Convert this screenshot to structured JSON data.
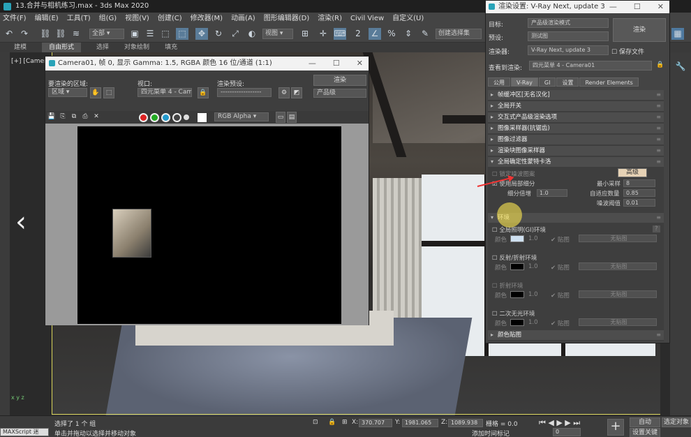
{
  "app": {
    "title": "13.合并与相机练习.max - 3ds Max 2020"
  },
  "menu": [
    "文件(F)",
    "编辑(E)",
    "工具(T)",
    "组(G)",
    "视图(V)",
    "创建(C)",
    "修改器(M)",
    "动画(A)",
    "图形编辑器(D)",
    "渲染(R)",
    "Civil View",
    "自定义(U)"
  ],
  "toolbar": {
    "select_filter": "全部",
    "view_dropdown": "视图",
    "selection_set": "创建选择集"
  },
  "ribbon": [
    "建模",
    "自由形式",
    "选择",
    "对象绘制",
    "填充"
  ],
  "viewport": {
    "label": "[+] [Camera01]",
    "axis": "x y z"
  },
  "frame_buffer": {
    "title": "Camera01, 帧 0, 显示 Gamma: 1.5, RGBA 颜色 16 位/通道 (1:1)",
    "area_label": "要渲染的区域:",
    "area_value": "区域",
    "viewport_label": "视口:",
    "viewport_value": "四元菜单 4 - Camera01",
    "preset_label": "渲染预设:",
    "preset_value": "------------------",
    "render_button": "渲染",
    "product_level": "产品级",
    "channel": "RGB Alpha"
  },
  "render_setup": {
    "title": "渲染设置: V-Ray Next, update 3",
    "target_label": "目标:",
    "target_value": "产品级渲染模式",
    "preset_label": "预设:",
    "preset_value": "测试图",
    "renderer_label": "渲染器:",
    "renderer_value": "V-Ray Next, update 3",
    "save_file": "保存文件",
    "view_label": "查看到渲染:",
    "view_value": "四元菜单 4 - Camera01",
    "render_button": "渲染",
    "tabs": [
      "公用",
      "V-Ray",
      "GI",
      "设置",
      "Render Elements"
    ],
    "rollouts": [
      "帧缓冲区[无名汉化]",
      "全局开关",
      "交互式产品级渲染选项",
      "图像采样器(抗锯齿)",
      "图像过滤器",
      "渲染块图像采样器"
    ],
    "dmc": {
      "header": "全局确定性蒙特卡洛",
      "lock_noise": "锁定噪波图案",
      "advanced": "高级",
      "use_local": "使用局部细分",
      "subdiv_mult_label": "细分倍增",
      "subdiv_mult_value": "1.0",
      "min_samples_label": "最小采样",
      "min_samples_value": "8",
      "adaptive_label": "自适应数量",
      "adaptive_value": "0.85",
      "noise_label": "噪波阈值",
      "noise_value": "0.01"
    },
    "environment": {
      "header": "环境",
      "gi_env": "全局照明(GI)环境",
      "refl_env": "反射/折射环境",
      "refr_env": "折射环境",
      "secondary": "二次无光环境",
      "color_label": "颜色",
      "mult": "1.0",
      "map_label": "贴图",
      "no_map": "无贴图"
    },
    "color_mapping": "颜色贴图"
  },
  "status": {
    "maxscript": "MAXScript 迷",
    "selected": "选择了 1 个 组",
    "prompt": "单击并拖动以选择并移动对象",
    "x_label": "X:",
    "x_value": "370.707",
    "y_label": "Y:",
    "y_value": "1981.065",
    "z_label": "Z:",
    "z_value": "1089.938",
    "grid": "栅格 = 0.0",
    "add_time_tag": "添加时间标记",
    "auto": "自动",
    "select_obj": "选定对象",
    "set_key": "设置关键点",
    "frame": "0"
  }
}
